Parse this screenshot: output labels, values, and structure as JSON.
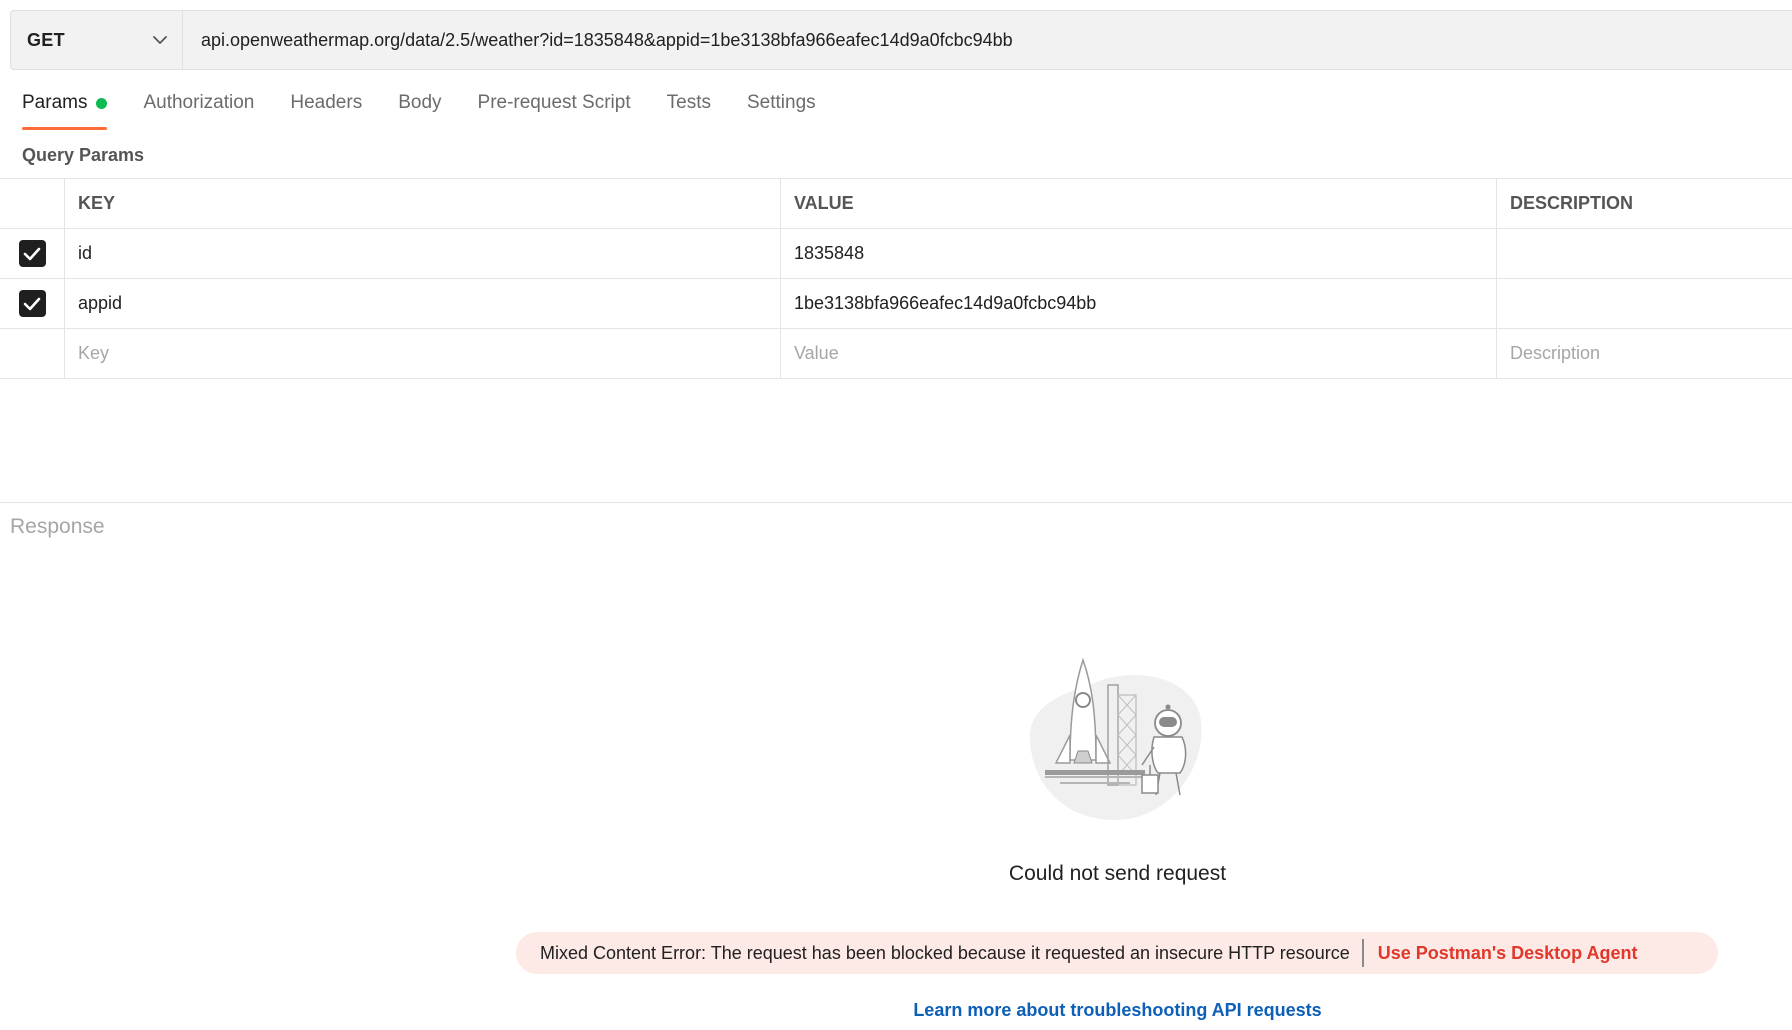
{
  "request": {
    "method": "GET",
    "url": "api.openweathermap.org/data/2.5/weather?id=1835848&appid=1be3138bfa966eafec14d9a0fcbc94bb"
  },
  "tabs": [
    {
      "label": "Params",
      "active": true
    },
    {
      "label": "Authorization"
    },
    {
      "label": "Headers"
    },
    {
      "label": "Body"
    },
    {
      "label": "Pre-request Script"
    },
    {
      "label": "Tests"
    },
    {
      "label": "Settings"
    }
  ],
  "params": {
    "title": "Query Params",
    "headers": {
      "key": "KEY",
      "value": "VALUE",
      "description": "DESCRIPTION"
    },
    "rows": [
      {
        "checked": true,
        "key": "id",
        "value": "1835848",
        "description": ""
      },
      {
        "checked": true,
        "key": "appid",
        "value": "1be3138bfa966eafec14d9a0fcbc94bb",
        "description": ""
      }
    ],
    "placeholders": {
      "key": "Key",
      "value": "Value",
      "description": "Description"
    }
  },
  "response": {
    "label": "Response",
    "error_title": "Could not send request",
    "error_message": "Mixed Content Error: The request has been blocked because it requested an insecure HTTP resource",
    "agent_link": "Use Postman's Desktop Agent",
    "learn_more": "Learn more about troubleshooting API requests"
  },
  "colors": {
    "accent": "#ff6c37",
    "status_dot": "#0cbb52",
    "error_bg": "#fde9e6",
    "error_link": "#e0382a",
    "link": "#0d5fb8"
  }
}
